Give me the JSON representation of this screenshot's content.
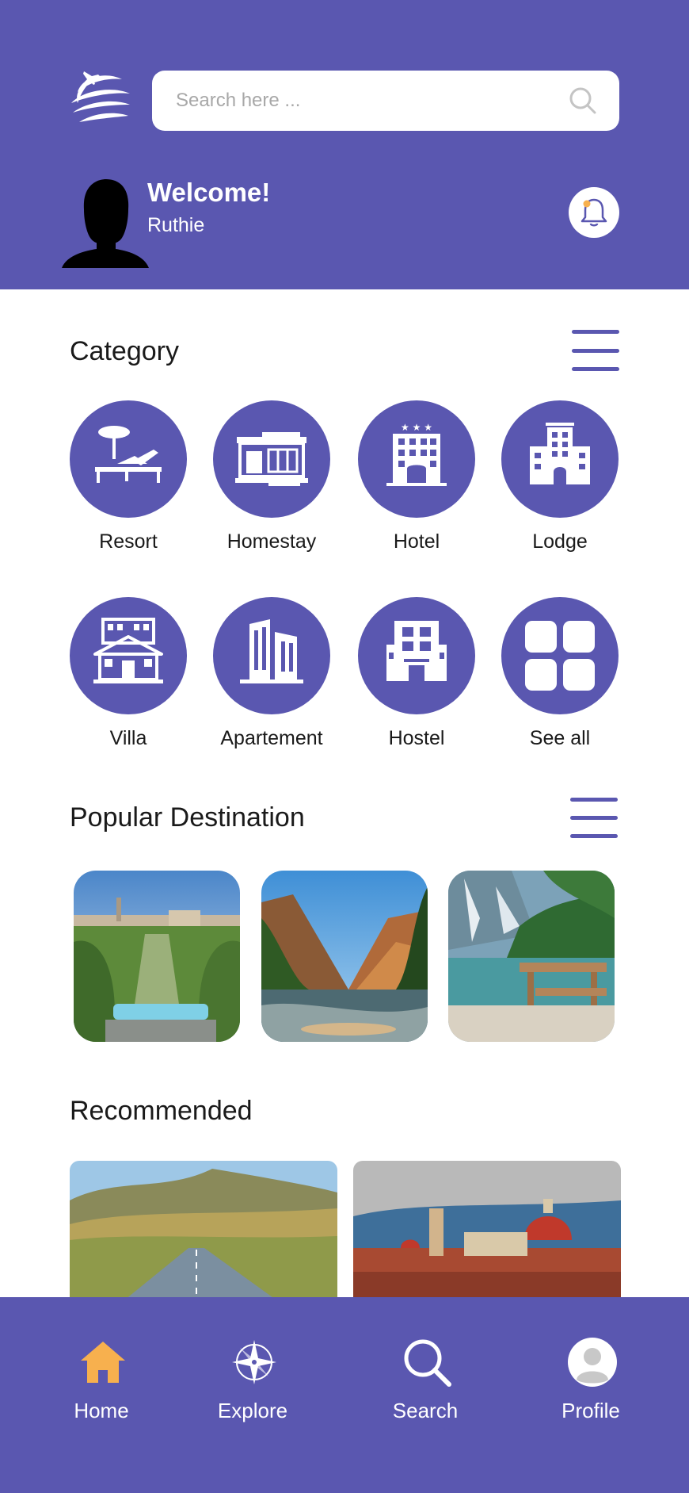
{
  "header": {
    "search_placeholder": "Search here ...",
    "welcome_title": "Welcome!",
    "user_name": "Ruthie"
  },
  "category": {
    "title": "Category",
    "items": [
      {
        "label": "Resort",
        "icon": "resort-icon"
      },
      {
        "label": "Homestay",
        "icon": "homestay-icon"
      },
      {
        "label": "Hotel",
        "icon": "hotel-icon"
      },
      {
        "label": "Lodge",
        "icon": "lodge-icon"
      },
      {
        "label": "Villa",
        "icon": "villa-icon"
      },
      {
        "label": "Apartement",
        "icon": "apartment-icon"
      },
      {
        "label": "Hostel",
        "icon": "hostel-icon"
      },
      {
        "label": "See all",
        "icon": "grid-icon"
      }
    ]
  },
  "popular": {
    "title": "Popular Destination"
  },
  "recommended": {
    "title": "Recommended"
  },
  "nav": {
    "items": [
      {
        "label": "Home",
        "icon": "home-icon"
      },
      {
        "label": "Explore",
        "icon": "compass-icon"
      },
      {
        "label": "Search",
        "icon": "search-icon"
      },
      {
        "label": "Profile",
        "icon": "profile-icon"
      }
    ]
  },
  "colors": {
    "primary": "#5a57b0",
    "accent": "#f7b04e",
    "background": "#ffffff"
  }
}
